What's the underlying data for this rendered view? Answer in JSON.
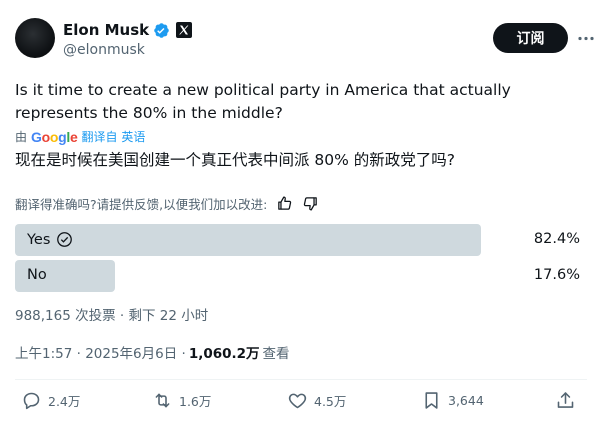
{
  "author": {
    "name": "Elon Musk",
    "handle": "@elonmusk",
    "subscribe_label": "订阅"
  },
  "tweet": {
    "text": "Is it time to create a new political party in America that actually represents the 80% in the middle?",
    "translated_by_prefix": "由",
    "translated_by_brand": "Google",
    "translated_from_label": "翻译自 英语",
    "translated_text": "现在是时候在美国创建一个真正代表中间派 80% 的新政党了吗?",
    "feedback_prompt": "翻译得准确吗?请提供反馈,以便我们加以改进:"
  },
  "poll": {
    "options": [
      {
        "label": "Yes",
        "percent": "82.4%",
        "fraction": 0.824,
        "winner": true
      },
      {
        "label": "No",
        "percent": "17.6%",
        "fraction": 0.176,
        "winner": false
      }
    ],
    "meta": "988,165 次投票 · 剩下 22 小时"
  },
  "meta": {
    "time": "上午1:57 · 2025年6月6日 ·",
    "views_count": "1,060.2万",
    "views_label": "查看"
  },
  "actions": {
    "reply_count": "2.4万",
    "retweet_count": "1.6万",
    "like_count": "4.5万",
    "bookmark_count": "3,644"
  },
  "colors": {
    "accent": "#1d9bf0",
    "verified": "#1d9bf0",
    "poll_bar": "#cfd9de",
    "muted": "#536471"
  }
}
